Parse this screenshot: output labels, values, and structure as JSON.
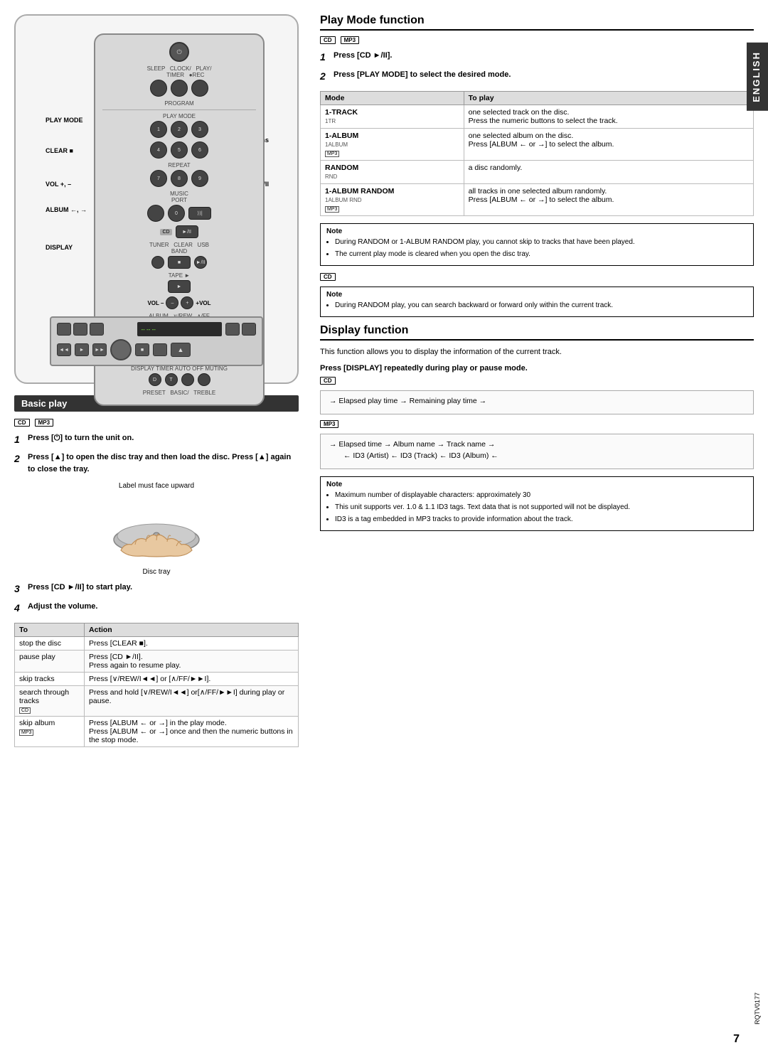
{
  "page": {
    "number": "7",
    "doc_code": "RQTV0177",
    "language": "ENGLISH"
  },
  "left_col": {
    "remote_labels": {
      "play_mode": "PLAY MODE",
      "clear": "CLEAR ■",
      "vol": "VOL +, –",
      "album": "ALBUM ←, →",
      "display": "DISPLAY",
      "numeric_buttons": "Numeric buttons",
      "cd_play_pause": "CD ►/II"
    },
    "basic_play": {
      "title": "Basic play",
      "badges": [
        "CD",
        "MP3"
      ],
      "steps": [
        {
          "num": "1",
          "text": "Press [⏻] to turn the unit on."
        },
        {
          "num": "2",
          "text": "Press [▲] to open the disc tray and then load the disc. Press [▲] again to close the tray."
        }
      ],
      "disc_image_label": "Label must face upward",
      "disc_tray_label": "Disc tray",
      "steps_after": [
        {
          "num": "3",
          "text": "Press [CD ►/II] to start play."
        },
        {
          "num": "4",
          "text": "Adjust the volume."
        }
      ],
      "action_table": {
        "headers": [
          "To",
          "Action"
        ],
        "rows": [
          {
            "to": "stop the disc",
            "action": "Press [CLEAR ■]."
          },
          {
            "to": "pause play",
            "action": "Press [CD ►/II].\nPress again to resume play."
          },
          {
            "to": "skip tracks",
            "action": "Press [∨/REW/I◄◄] or [∧/FF/►►I]."
          },
          {
            "to": "search through tracks",
            "action": "Press and hold [∨/REW/I◄◄] or[∧/FF/►►I] during play or pause.",
            "badge": "CD"
          },
          {
            "to": "skip album",
            "action": "Press [ALBUM ← or →] in the play mode. Press [ALBUM ← or →] once and then the numeric buttons in the stop mode.",
            "badge": "MP3"
          }
        ]
      }
    }
  },
  "right_col": {
    "play_mode_function": {
      "title": "Play Mode function",
      "badges": [
        "CD",
        "MP3"
      ],
      "steps": [
        {
          "num": "1",
          "text": "Press [CD ►/II]."
        },
        {
          "num": "2",
          "text": "Press [PLAY MODE] to select the desired mode."
        }
      ],
      "mode_table": {
        "headers": [
          "Mode",
          "To play"
        ],
        "rows": [
          {
            "mode_name": "1-TRACK",
            "mode_sub": "1TR",
            "to_play": "one selected track on the disc.\nPress the numeric buttons to select the track."
          },
          {
            "mode_name": "1-ALBUM",
            "mode_sub": "1ALBUM",
            "badge": "MP3",
            "to_play": "one selected album on the disc.\nPress [ALBUM ← or →] to select the album."
          },
          {
            "mode_name": "RANDOM",
            "mode_sub": "RND",
            "to_play": "a disc randomly."
          },
          {
            "mode_name": "1-ALBUM RANDOM",
            "mode_sub": "1ALBUM RND",
            "badge": "MP3",
            "to_play": "all tracks in one selected album randomly.\nPress [ALBUM ← or →] to select the album."
          }
        ]
      },
      "notes": [
        "During RANDOM or 1-ALBUM RANDOM play, you cannot skip to tracks that have been played.",
        "The current play mode is cleared when you open the disc tray."
      ],
      "note2_badge": "CD",
      "note2": "During RANDOM play, you can search backward or forward only within the current track."
    },
    "display_function": {
      "title": "Display function",
      "description": "This function allows you to display the information of the current track.",
      "instruction": "Press [DISPLAY] repeatedly during play or pause mode.",
      "cd_badge": "CD",
      "cd_diagram": {
        "line1": "→ Elapsed play time → Remaining play time →"
      },
      "mp3_badge": "MP3",
      "mp3_diagram": {
        "line1": "→ Elapsed time → Album name → Track name →",
        "line2": "← ID3 (Artist) ← ID3 (Track) ← ID3 (Album) ←"
      },
      "notes": [
        "Maximum number of displayable characters: approximately 30",
        "This unit supports ver. 1.0 & 1.1 ID3 tags. Text data that is not supported will not be displayed.",
        "ID3 is a tag embedded in MP3 tracks to provide information about the track."
      ]
    }
  }
}
